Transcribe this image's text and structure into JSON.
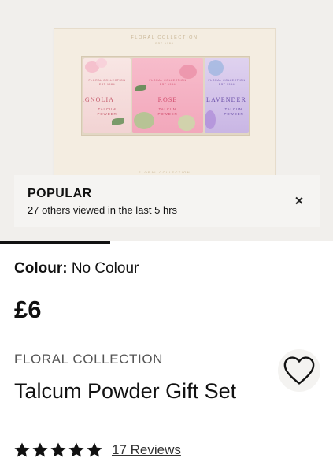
{
  "gallery": {
    "box_header": "FLORAL COLLECTION",
    "box_header_sub": "EST 1984",
    "box_footer": "FLORAL COLLECTION",
    "tins": [
      {
        "name": "MAGNOLIA",
        "brand": "FLORAL COLLECTION",
        "est": "EST 1984",
        "type_line1": "TALCUM",
        "type_line2": "POWDER"
      },
      {
        "name": "ROSE",
        "brand": "FLORAL COLLECTION",
        "est": "EST 1984",
        "type_line1": "TALCUM",
        "type_line2": "POWDER"
      },
      {
        "name": "LAVENDER",
        "brand": "FLORAL COLLECTION",
        "est": "EST 1984",
        "type_line1": "TALCUM",
        "type_line2": "POWDER"
      }
    ],
    "progress": 0.33
  },
  "popular_banner": {
    "title": "POPULAR",
    "subtitle": "27 others viewed in the last 5 hrs",
    "close_icon": "close-icon"
  },
  "product": {
    "colour_label": "Colour:",
    "colour_value": "No Colour",
    "price": "£6",
    "brand": "FLORAL COLLECTION",
    "title": "Talcum Powder Gift Set",
    "wishlist_icon": "heart-outline-icon",
    "rating": 5,
    "rating_max": 5,
    "reviews_label": "17 Reviews"
  },
  "colors": {
    "text": "#111111",
    "banner_bg": "#f5f4f2",
    "gallery_bg": "#f1efec"
  }
}
